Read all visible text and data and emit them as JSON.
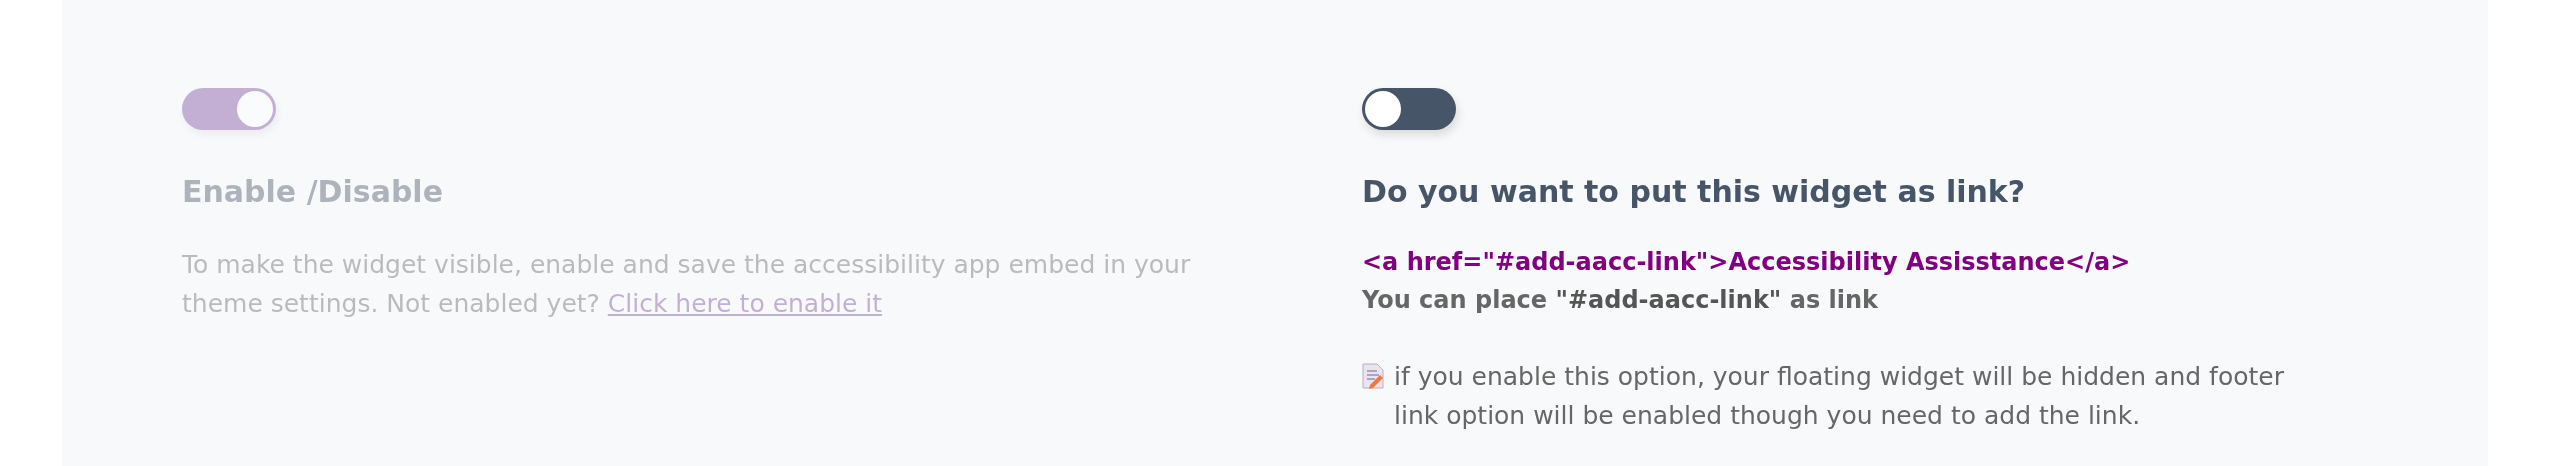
{
  "settings": [
    {
      "kind": "enable",
      "disabled": true,
      "toggle": {
        "on": true
      },
      "title": "Enable /Disable",
      "description": "To make the widget visible, enable and save the accessibility app embed in your theme settings. Not enabled yet?",
      "link": "Click here to enable it"
    },
    {
      "kind": "widget-link",
      "disabled": false,
      "toggle": {
        "on": false
      },
      "title": "Do you want to put this widget as link?",
      "code": "<a href=\"#add-aacc-link\">Accessibility Assisstance</a>",
      "hint": "You can place **\"#add-aacc-link\"** as link",
      "note": "if you enable this option, your floating widget will be hidden and footer link option will be enabled though you need to add the link."
    }
  ]
}
